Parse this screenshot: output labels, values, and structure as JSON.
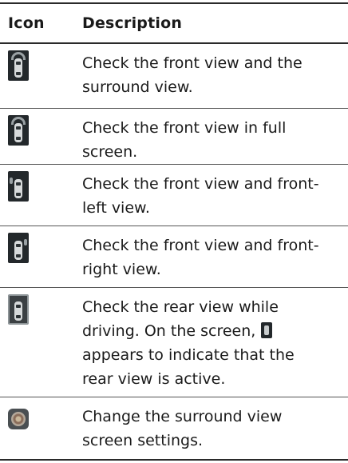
{
  "header": {
    "icon": "Icon",
    "description": "Description"
  },
  "rows": [
    {
      "icon": "front-surround-view-icon",
      "text": "Check the front view and the surround view."
    },
    {
      "icon": "front-full-view-icon",
      "text": "Check the front view in full screen."
    },
    {
      "icon": "front-left-view-icon",
      "text": "Check the front view and front-left view."
    },
    {
      "icon": "front-right-view-icon",
      "text": "Check the front view and front-right view."
    },
    {
      "icon": "rear-view-icon",
      "text_before": "Check the rear view while driving. On the screen,",
      "text_after": "appears to indicate that the rear view is active."
    },
    {
      "icon": "settings-gear-icon",
      "text": "Change the surround view screen settings."
    }
  ]
}
